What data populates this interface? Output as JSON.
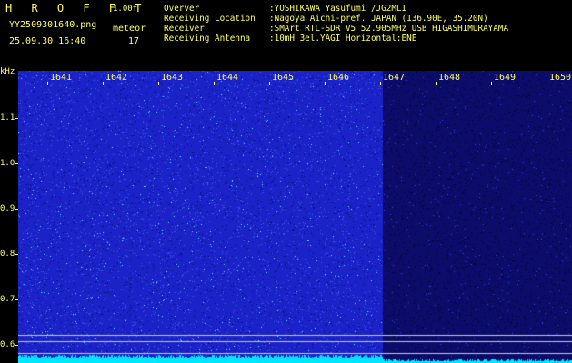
{
  "header": {
    "program": "H R O F F T",
    "version": "1.00f",
    "filename": "YY2509301640.png",
    "timestamp": "25.09.30 16:40",
    "mode_label": "meteor",
    "meteor_count": "17"
  },
  "info": [
    {
      "key": "Overver",
      "value": ":YOSHIKAWA Yasufumi /JG2MLI"
    },
    {
      "key": "Receiving Location",
      "value": ":Nagoya Aichi-pref. JAPAN (136.90E, 35.20N)"
    },
    {
      "key": "Receiver",
      "value": ":SMArt RTL-SDR V5 52.905MHz USB HIGASHIMURAYAMA"
    },
    {
      "key": "Receiving Antenna",
      "value": ":10mH 3el.YAGI Horizontal:ENE"
    }
  ],
  "plot": {
    "y_unit": "kHz",
    "y_ticks": [
      {
        "label": "1.1",
        "value": 1.1
      },
      {
        "label": "1.0",
        "value": 1.0
      },
      {
        "label": "0.9",
        "value": 0.9
      },
      {
        "label": "0.8",
        "value": 0.8
      },
      {
        "label": "0.7",
        "value": 0.7
      },
      {
        "label": "0.6",
        "value": 0.6
      }
    ],
    "x_ticks": [
      "1641",
      "1642",
      "1643",
      "1644",
      "1645",
      "1646",
      "1647",
      "1648",
      "1649",
      "1650"
    ],
    "colors": {
      "label": "#ffff66",
      "background_blue": "#1a22c8",
      "dark_blue": "#0c0c6a",
      "noise_cyan": "#55e0ff",
      "baseline_cyan": "#00e5ff",
      "reference_line": "#cccccc"
    }
  }
}
